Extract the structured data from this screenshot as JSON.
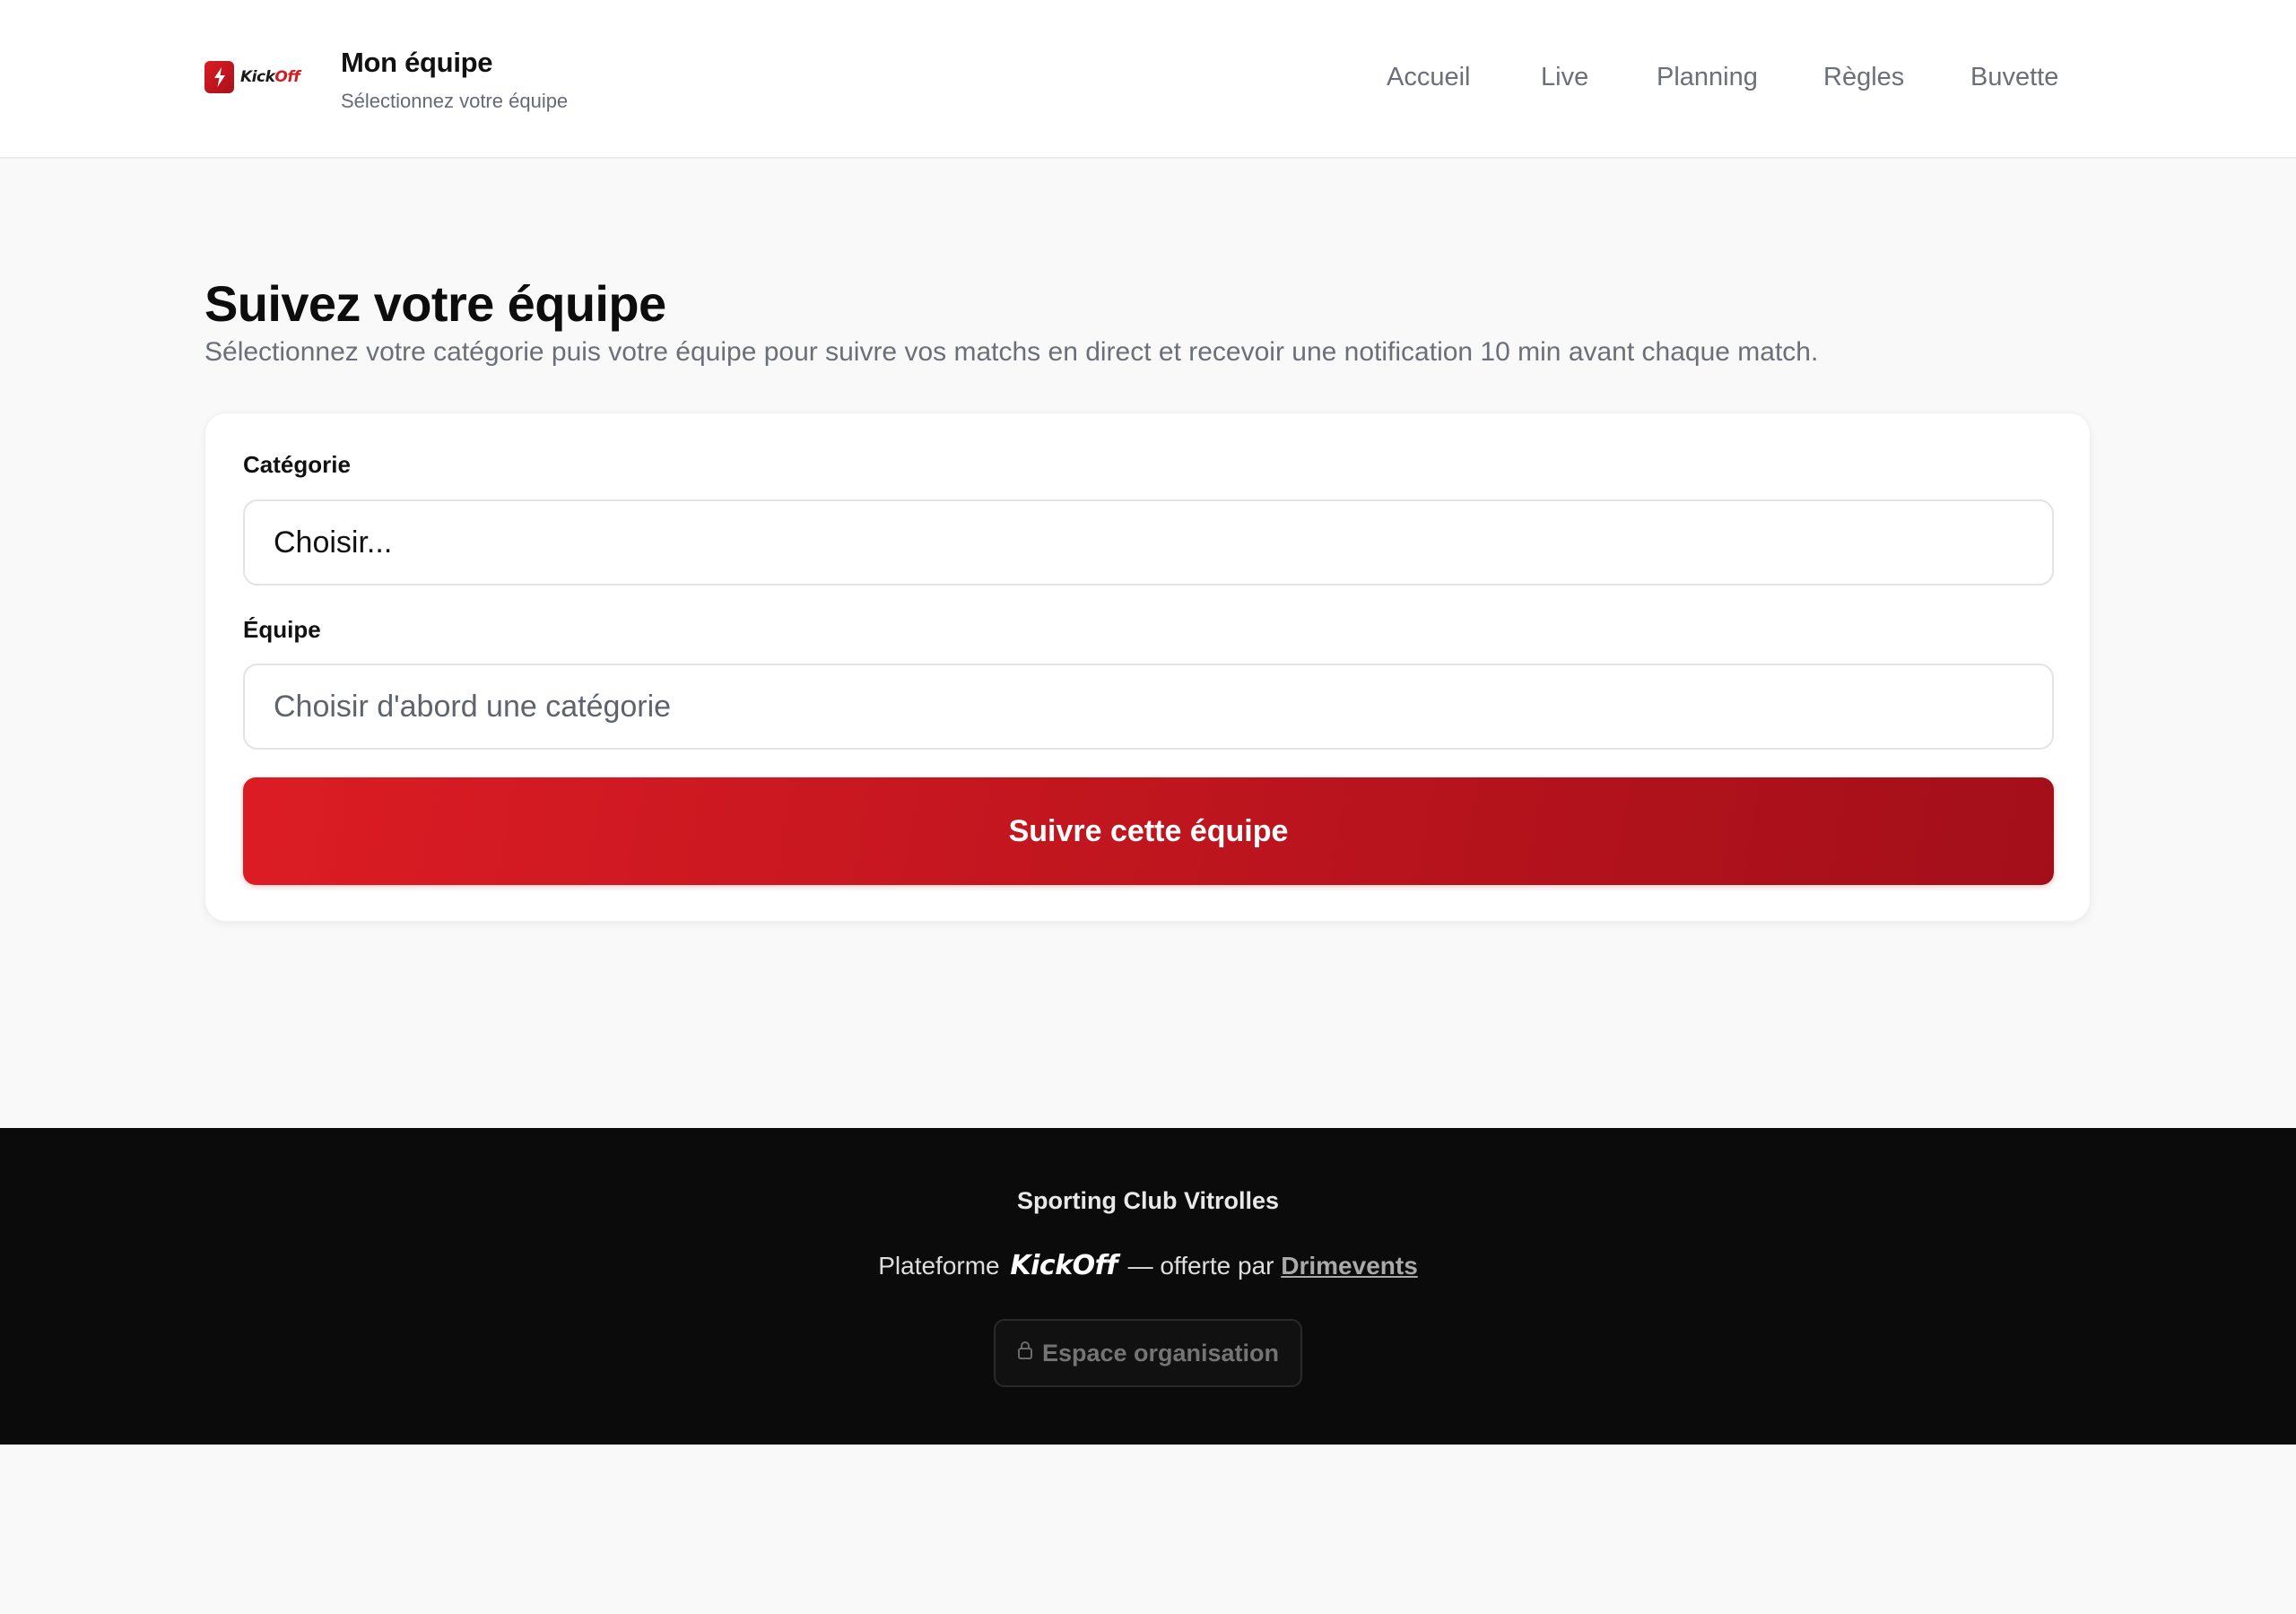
{
  "header": {
    "logo": {
      "prefix": "Kick",
      "suffix": "Off"
    },
    "title": "Mon équipe",
    "subtitle": "Sélectionnez votre équipe",
    "nav": [
      "Accueil",
      "Live",
      "Planning",
      "Règles",
      "Buvette"
    ]
  },
  "main": {
    "heading": "Suivez votre équipe",
    "description": "Sélectionnez votre catégorie puis votre équipe pour suivre vos matchs en direct et recevoir une notification 10 min avant chaque match.",
    "form": {
      "category_label": "Catégorie",
      "category_value": "Choisir...",
      "team_label": "Équipe",
      "team_value": "Choisir d'abord une catégorie",
      "submit_label": "Suivre cette équipe"
    }
  },
  "footer": {
    "club_name": "Sporting Club Vitrolles",
    "platform_prefix": "Plateforme",
    "platform_name": "KickOff",
    "platform_middle": "— offerte par",
    "partner_name": "Drimevents",
    "org_button_label": "Espace organisation"
  },
  "colors": {
    "brand_red": "#dc1c24",
    "brand_red_dark": "#a30f19",
    "footer_bg": "#0b0b0b",
    "page_bg": "#f9f9f9"
  },
  "icons": {
    "logo": "lightning-bolt-icon",
    "org_button": "lock-icon"
  }
}
